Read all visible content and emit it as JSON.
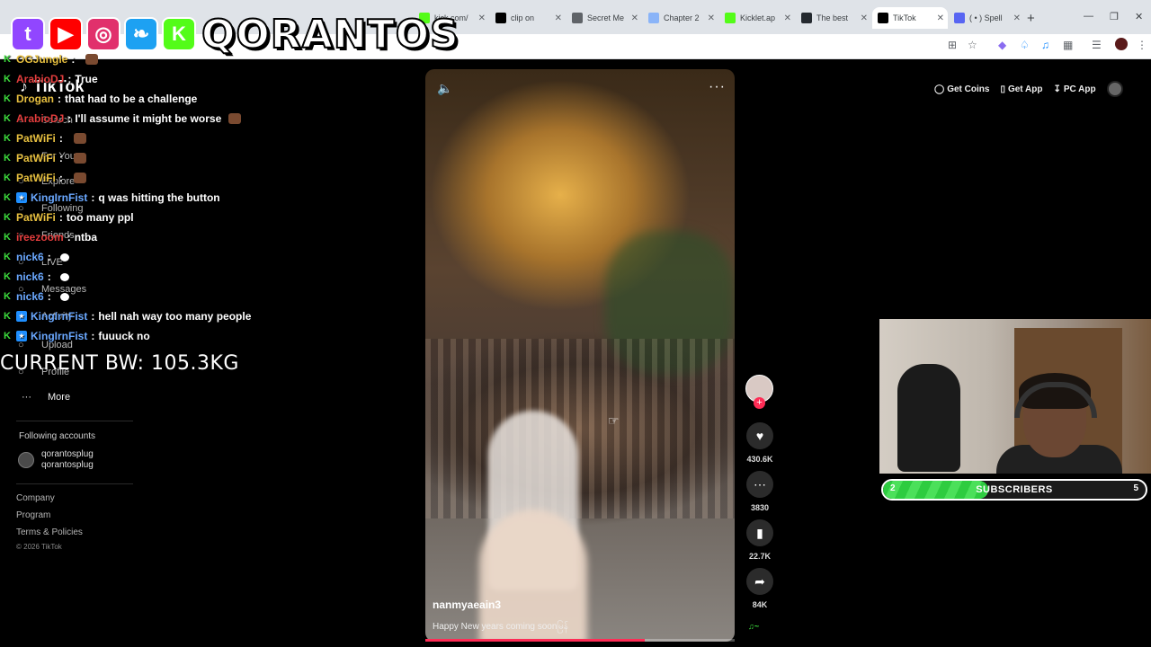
{
  "browser": {
    "tabs": [
      {
        "label": "kick.com/",
        "icon": "kick-icon",
        "color": "#53fc18"
      },
      {
        "label": "clip on",
        "icon": "x-icon",
        "color": "#000000"
      },
      {
        "label": "Secret Me",
        "icon": "globe-icon",
        "color": "#5f6368"
      },
      {
        "label": "Chapter 2",
        "icon": "doc-icon",
        "color": "#8ab4f8"
      },
      {
        "label": "Kicklet.ap",
        "icon": "kicklet-icon",
        "color": "#53fc18"
      },
      {
        "label": "The best",
        "icon": "github-icon",
        "color": "#24292f"
      },
      {
        "label": "TikTok",
        "icon": "tiktok-icon",
        "color": "#000000"
      },
      {
        "label": "( • ) Spell",
        "icon": "discord-icon",
        "color": "#5865f2"
      }
    ],
    "new_tab": "+"
  },
  "overlay": {
    "brand": "QORANTOS",
    "social_icons": [
      {
        "name": "twitch-icon",
        "glyph": "t",
        "color": "#9146ff"
      },
      {
        "name": "youtube-icon",
        "glyph": "▶",
        "color": "#ff0000"
      },
      {
        "name": "instagram-icon",
        "glyph": "◎",
        "color": "#e1306c"
      },
      {
        "name": "twitter-icon",
        "glyph": "❧",
        "color": "#1da1f2"
      },
      {
        "name": "kick-icon",
        "glyph": "K",
        "color": "#53fc18"
      }
    ],
    "current_bw": "CURRENT BW: 105.3KG"
  },
  "chat": [
    {
      "user": "OGJungle",
      "text": "",
      "color": "#e8c040",
      "badge": "kick",
      "emote": true
    },
    {
      "user": "ArabioDJ",
      "text": "True",
      "color": "#e33d3d",
      "badge": "kick",
      "emote": false
    },
    {
      "user": "Drogan",
      "text": "that had to be a challenge",
      "color": "#e8c040",
      "badge": "kick",
      "emote": false
    },
    {
      "user": "ArabioDJ",
      "text": "I'll assume it might be worse",
      "color": "#e33d3d",
      "badge": "kick",
      "emote": true
    },
    {
      "user": "PatWiFi",
      "text": "",
      "color": "#e8c040",
      "badge": "kick",
      "emote": true
    },
    {
      "user": "PatWiFi",
      "text": "",
      "color": "#e8c040",
      "badge": "kick",
      "emote": true
    },
    {
      "user": "PatWiFi",
      "text": "",
      "color": "#e8c040",
      "badge": "kick",
      "emote": true
    },
    {
      "user": "KingIrnFist",
      "text": "q was hitting the button",
      "color": "#6aa8ff",
      "badge": "sub",
      "emote": false
    },
    {
      "user": "PatWiFi",
      "text": "too many ppl",
      "color": "#e8c040",
      "badge": "kick",
      "emote": false
    },
    {
      "user": "ireezoom",
      "text": "ntba",
      "color": "#e33d3d",
      "badge": "kick",
      "emote": false
    },
    {
      "user": "nick6",
      "text": "",
      "color": "#6aa8ff",
      "badge": "kick",
      "emote": false
    },
    {
      "user": "nick6",
      "text": "",
      "color": "#6aa8ff",
      "badge": "kick",
      "emote": false
    },
    {
      "user": "nick6",
      "text": "",
      "color": "#6aa8ff",
      "badge": "kick",
      "emote": false
    },
    {
      "user": "KingIrnFist",
      "text": "hell nah way too many people",
      "color": "#6aa8ff",
      "badge": "sub",
      "emote": false
    },
    {
      "user": "KingIrnFist",
      "text": "fuuuck no",
      "color": "#6aa8ff",
      "badge": "sub",
      "emote": false
    }
  ],
  "tiktok": {
    "logo": "TikTok",
    "nav": [
      {
        "label": "Search",
        "icon": "search-icon"
      },
      {
        "label": "For You",
        "icon": "home-icon"
      },
      {
        "label": "Explore",
        "icon": "compass-icon"
      },
      {
        "label": "Following",
        "icon": "users-icon"
      },
      {
        "label": "Friends",
        "icon": "friends-icon"
      },
      {
        "label": "LIVE",
        "icon": "live-icon"
      },
      {
        "label": "Messages",
        "icon": "messages-icon"
      },
      {
        "label": "Activity",
        "icon": "bell-icon"
      },
      {
        "label": "Upload",
        "icon": "upload-icon"
      },
      {
        "label": "Profile",
        "icon": "profile-icon"
      }
    ],
    "more": "More",
    "following_title": "Following accounts",
    "following_account": {
      "display": "qorantosplug",
      "handle": "qorantosplug"
    },
    "footer": [
      "Company",
      "Program",
      "Terms & Policies"
    ],
    "copyright": "© 2026 TikTok",
    "top_actions": {
      "coins": "Get Coins",
      "app": "Get App",
      "pc": "PC App"
    }
  },
  "video": {
    "username": "nanmyaeain3",
    "caption": "Happy New years  coming soonမြန်",
    "progress": 0.71,
    "likes": "430.6K",
    "comments": "3830",
    "saves": "22.7K",
    "shares": "84K"
  },
  "subgoal": {
    "start": "2",
    "label": "SUBSCRIBERS",
    "end": "5",
    "progress": 0.4,
    "accent": "#2ecc40"
  }
}
